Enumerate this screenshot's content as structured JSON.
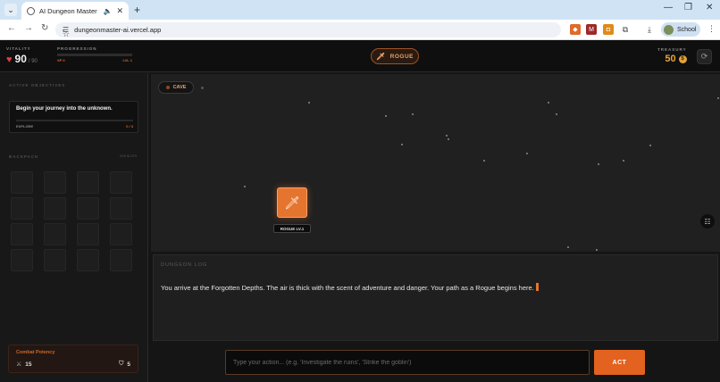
{
  "browser": {
    "tab_title": "AI Dungeon Master",
    "url": "dungeonmaster-ai.vercel.app",
    "profile_label": "School"
  },
  "header": {
    "vitality_label": "VITALITY",
    "vitality_value": "90",
    "vitality_max": "/ 90",
    "progression_label": "PROGRESSION",
    "xp_text": "XP 0",
    "level_text": "LVL 1",
    "progress_fraction": 0.0,
    "class_name": "ROGUE",
    "treasury_label": "TREASURY",
    "treasury_value": "50"
  },
  "sidebar": {
    "objectives_heading": "ACTIVE OBJECTIVES",
    "objective_title": "Begin your journey into the unknown.",
    "objective_type": "EXPLORE",
    "objective_progress": "0 / 3",
    "backpack_heading": "BACKPACK",
    "backpack_caption": "0/16 SLOTS",
    "potency_title": "Combat Potency",
    "attack_value": "15",
    "defense_value": "5"
  },
  "map": {
    "location": "CAVE",
    "player_label": "ROGUE LV.1"
  },
  "log": {
    "heading": "DUNGEON LOG",
    "entry": "You arrive at the Forgotten Depths. The air is thick with the scent of adventure and danger. Your path as a Rogue begins here."
  },
  "input": {
    "placeholder": "Type your action... (e.g. 'Investigate the ruins', 'Strike the goblin')",
    "act_label": "ACT"
  },
  "colors": {
    "accent": "#e5752e",
    "gold": "#e9a237",
    "heart": "#e23b3b"
  }
}
